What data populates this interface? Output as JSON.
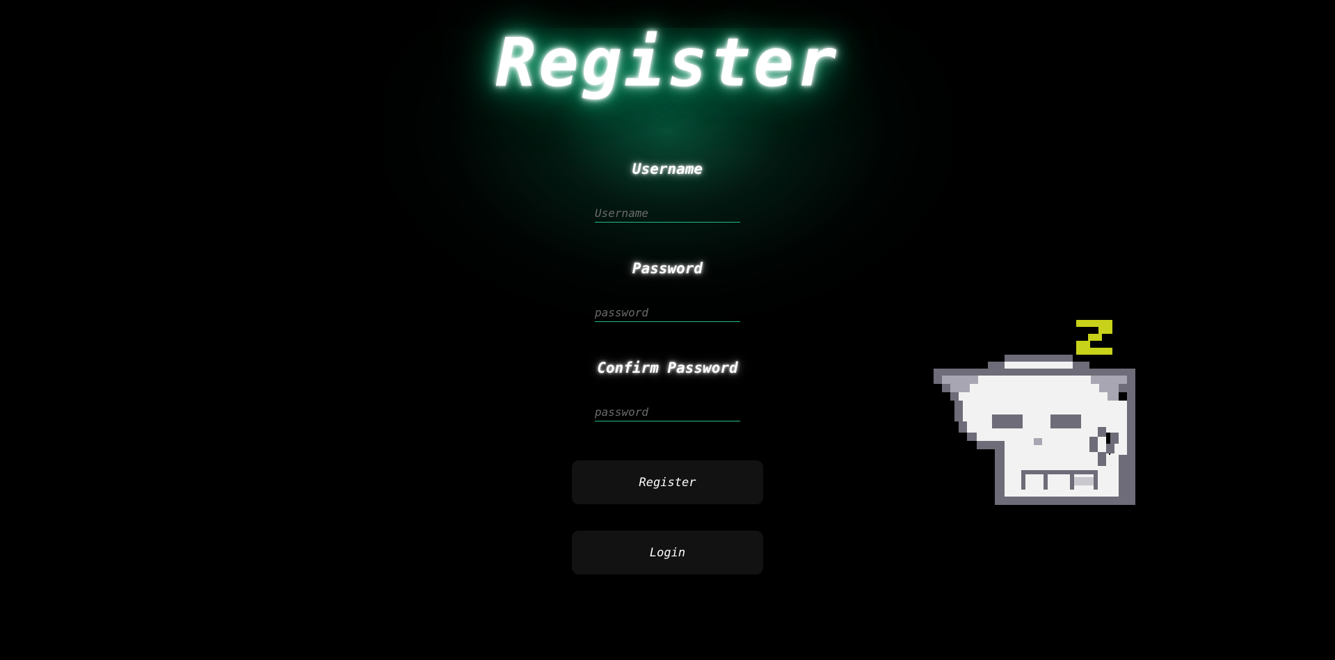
{
  "page": {
    "title": "Register"
  },
  "form": {
    "username": {
      "label": "Username",
      "placeholder": "Username",
      "value": ""
    },
    "password": {
      "label": "Password",
      "placeholder": "password",
      "value": ""
    },
    "confirm_password": {
      "label": "Confirm Password",
      "placeholder": "password",
      "value": ""
    },
    "register_button": "Register",
    "login_button": "Login"
  },
  "mascot": {
    "icon": "sleeping-cat-icon",
    "sleep_glyph": "Z"
  },
  "colors": {
    "background": "#000000",
    "accent": "#1fbf86",
    "button_bg": "#121212",
    "zzz": "#c8d21a"
  }
}
